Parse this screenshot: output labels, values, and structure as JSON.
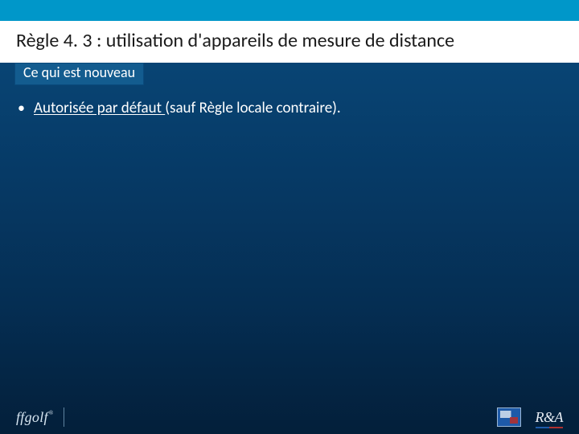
{
  "title": "Règle 4. 3 : utilisation d'appareils de mesure de distance",
  "subtitle": "Ce qui est nouveau",
  "bullet": {
    "underlined": "Autorisée par défaut ",
    "rest": "(sauf Règle locale contraire)."
  },
  "footer": {
    "left_logo_text": "ffgolf",
    "right_logo_text": "R&A"
  }
}
